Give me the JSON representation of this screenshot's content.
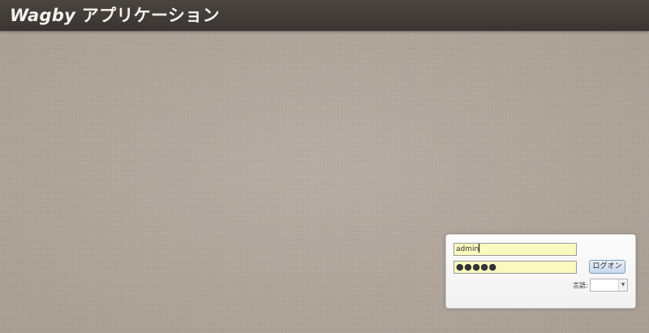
{
  "header": {
    "brand": "Wagby",
    "title_suffix": " アプリケーション"
  },
  "login": {
    "username_value": "admin",
    "password_value": "●●●●●",
    "login_button_label": "ログオン",
    "language_label": "言語:",
    "language_selected": ""
  }
}
